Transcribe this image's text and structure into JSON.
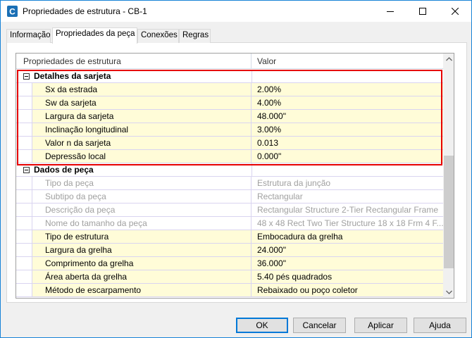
{
  "window": {
    "title": "Propriedades de estrutura - CB-1",
    "icon": "civil3d-c-icon",
    "controls": [
      "minimize-icon",
      "maximize-icon",
      "close-icon"
    ]
  },
  "tabs": [
    {
      "label": "Informação",
      "active": false
    },
    {
      "label": "Propriedades da peça",
      "active": true
    },
    {
      "label": "Conexões",
      "active": false
    },
    {
      "label": "Regras",
      "active": false
    }
  ],
  "grid": {
    "columns": [
      "Propriedades de estrutura",
      "Valor"
    ],
    "groups": [
      {
        "label": "Detalhes da sarjeta",
        "expanded": true,
        "rows": [
          {
            "name": "Sx da estrada",
            "value": "2.00%",
            "enabled": true
          },
          {
            "name": "Sw da sarjeta",
            "value": "4.00%",
            "enabled": true
          },
          {
            "name": "Largura da sarjeta",
            "value": "48.000\"",
            "enabled": true
          },
          {
            "name": "Inclinação longitudinal",
            "value": "3.00%",
            "enabled": true
          },
          {
            "name": "Valor n da sarjeta",
            "value": "0.013",
            "enabled": true
          },
          {
            "name": "Depressão local",
            "value": "0.000\"",
            "enabled": true
          }
        ]
      },
      {
        "label": "Dados de peça",
        "expanded": true,
        "rows": [
          {
            "name": "Tipo da peça",
            "value": "Estrutura da junção",
            "enabled": false
          },
          {
            "name": "Subtipo da peça",
            "value": "Rectangular",
            "enabled": false
          },
          {
            "name": "Descrição da peça",
            "value": "Rectangular Structure 2-Tier Rectangular Frame",
            "enabled": false
          },
          {
            "name": "Nome do tamanho da peça",
            "value": "48 x 48 Rect Two Tier Structure 18 x 18 Frm 4 F...",
            "enabled": false
          },
          {
            "name": "Tipo de estrutura",
            "value": "Embocadura da grelha",
            "enabled": true
          },
          {
            "name": "Largura da grelha",
            "value": "24.000\"",
            "enabled": true
          },
          {
            "name": "Comprimento da grelha",
            "value": "36.000\"",
            "enabled": true
          },
          {
            "name": "Área aberta da grelha",
            "value": "5.40 pés quadrados",
            "enabled": true
          },
          {
            "name": "Método de escarpamento",
            "value": "Rebaixado ou poço coletor",
            "enabled": true
          }
        ]
      }
    ]
  },
  "buttons": {
    "ok": "OK",
    "cancel": "Cancelar",
    "apply": "Aplicar",
    "help": "Ajuda"
  },
  "colors": {
    "editable_row_bg": "#fffcd8",
    "disabled_text": "#a0a0a0",
    "highlight_border": "#e60000",
    "accent": "#0078d7"
  }
}
